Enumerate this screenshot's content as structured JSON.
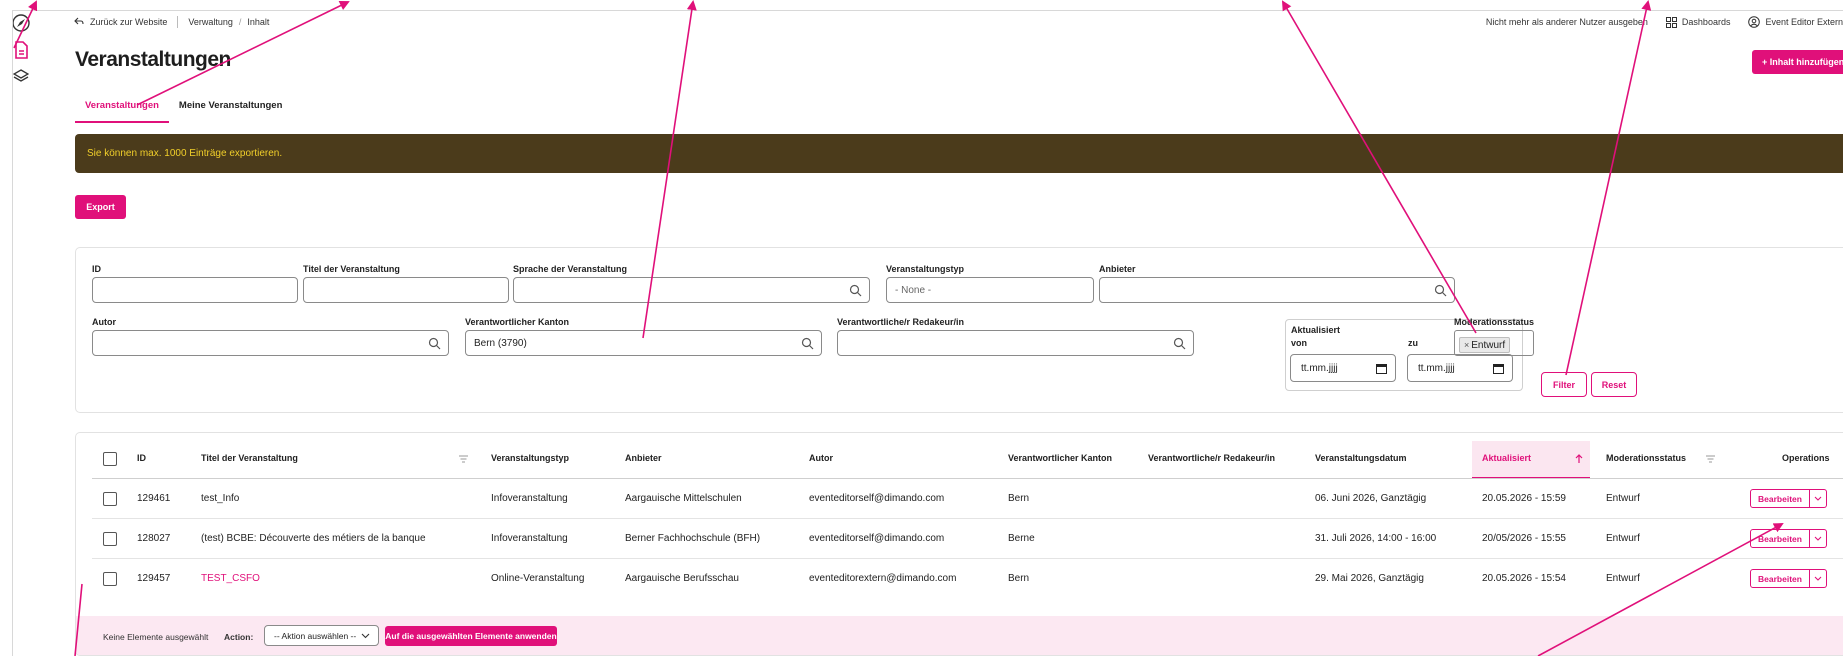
{
  "toolbar": {
    "back_label": "Zurück zur Website",
    "crumbs": [
      "Verwaltung",
      "Inhalt"
    ],
    "crumb_sep": "/",
    "switch_user": "Nicht mehr als anderer Nutzer ausgeben",
    "dashboards": "Dashboards",
    "user_name": "Event Editor Extern"
  },
  "page": {
    "title": "Veranstaltungen",
    "add_button": "+ Inhalt hinzufügen",
    "tabs": [
      {
        "label": "Veranstaltungen",
        "active": true
      },
      {
        "label": "Meine Veranstaltungen",
        "active": false
      }
    ],
    "notice": "Sie können max. 1000 Einträge exportieren.",
    "export_button": "Export"
  },
  "filters": {
    "id_label": "ID",
    "title_label": "Titel der Veranstaltung",
    "language_label": "Sprache der Veranstaltung",
    "type_label": "Veranstaltungstyp",
    "type_value": "- None -",
    "provider_label": "Anbieter",
    "author_label": "Autor",
    "canton_label": "Verantwortlicher Kanton",
    "canton_value": "Bern (3790)",
    "editor_label": "Verantwortliche/r Redakeur/in",
    "updated_label": "Aktualisiert",
    "from_label": "von",
    "to_label": "zu",
    "date_placeholder": "tt.mm.jjjj",
    "moderation_label": "Moderationsstatus",
    "moderation_chip": "Entwurf",
    "chip_remove": "×",
    "filter_button": "Filter",
    "reset_button": "Reset"
  },
  "table": {
    "headers": {
      "id": "ID",
      "title": "Titel der Veranstaltung",
      "type": "Veranstaltungstyp",
      "provider": "Anbieter",
      "author": "Autor",
      "canton": "Verantwortlicher Kanton",
      "editor": "Verantwortliche/r Redakeur/in",
      "date": "Veranstaltungsdatum",
      "updated": "Aktualisiert",
      "moderation": "Moderationsstatus",
      "operations": "Operations"
    },
    "rows": [
      {
        "id": "129461",
        "title": "test_Info",
        "type": "Infoveranstaltung",
        "provider": "Aargauische Mittelschulen",
        "author": "eventeditorself@dimando.com",
        "canton": "Bern",
        "date": "06. Juni 2026, Ganztägig",
        "updated": "20.05.2026 - 15:59",
        "moderation": "Entwurf",
        "edit": "Bearbeiten"
      },
      {
        "id": "128027",
        "title": "(test) BCBE: Découverte des métiers de la banque",
        "type": "Infoveranstaltung",
        "provider": "Berner Fachhochschule (BFH)",
        "author": "eventeditorself@dimando.com",
        "canton": "Berne",
        "date": "31. Juli 2026, 14:00 - 16:00",
        "updated": "20/05/2026 - 15:55",
        "moderation": "Entwurf",
        "edit": "Bearbeiten"
      },
      {
        "id": "129457",
        "title": "TEST_CSFO",
        "type": "Online-Veranstaltung",
        "provider": "Aargauische Berufsschau",
        "author": "eventeditorextern@dimando.com",
        "canton": "Bern",
        "date": "29. Mai 2026, Ganztägig",
        "updated": "20.05.2026 - 15:54",
        "moderation": "Entwurf",
        "edit": "Bearbeiten"
      }
    ],
    "bulk": {
      "none_selected": "Keine Elemente ausgewählt",
      "action_label": "Action:",
      "action_select": "-- Aktion auswählen --",
      "apply_button": "Auf die ausgewählten Elemente anwenden"
    }
  },
  "colors": {
    "accent": "#e0107a",
    "notice_bg": "#4b3b1b",
    "notice_text": "#f1cf2a"
  }
}
